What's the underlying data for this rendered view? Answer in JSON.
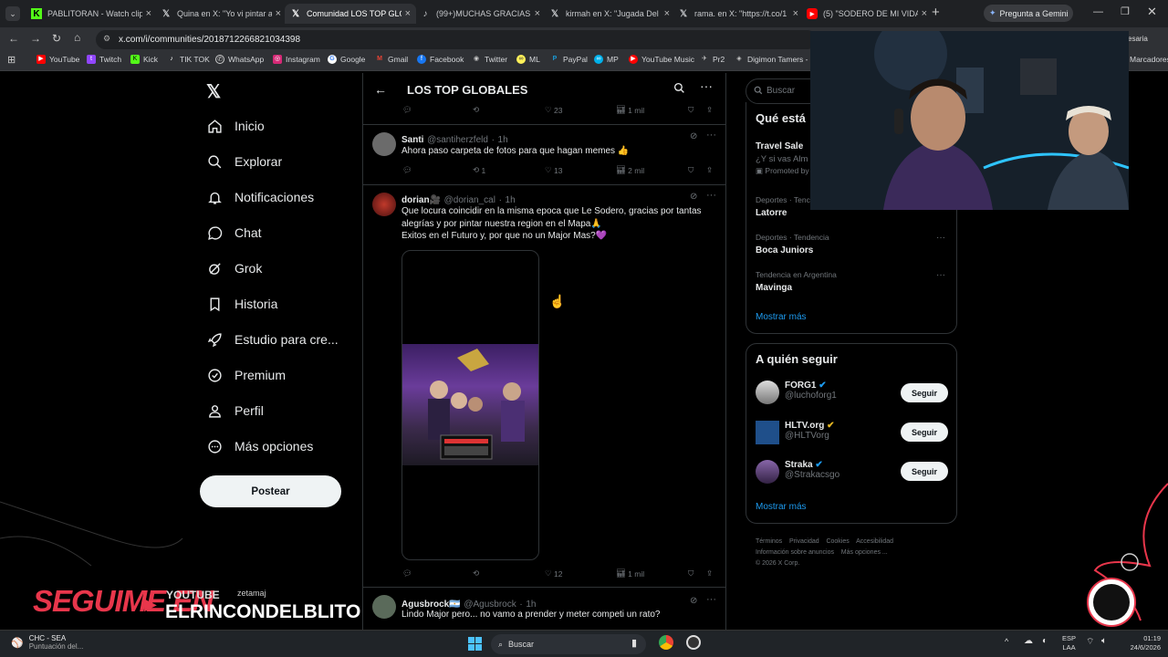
{
  "browser": {
    "tabs": [
      {
        "title": "PABLITORAN - Watch clips",
        "icon": "kick-icon",
        "active": false
      },
      {
        "title": "Quina en X: \"Yo vi pintar a",
        "icon": "x-icon",
        "active": false
      },
      {
        "title": "Comunidad LOS TOP GLOBA",
        "icon": "x-icon",
        "active": true
      },
      {
        "title": "(99+)MUCHAS GRACIAS S",
        "icon": "tiktok-icon",
        "active": false
      },
      {
        "title": "kirmah en X: \"Jugada Del N",
        "icon": "x-icon",
        "active": false
      },
      {
        "title": "rama. en X: \"https://t.co/1",
        "icon": "x-icon",
        "active": false
      },
      {
        "title": "(5) \"SODERO DE MI VIDA\"",
        "icon": "youtube-icon",
        "active": false
      }
    ],
    "gemini_button": "Pregunta a Gemini",
    "url": "x.com/i/communities/2018712266821034398",
    "bookmarks": [
      "YouTube",
      "Twitch",
      "Kick",
      "TIK TOK",
      "WhatsApp",
      "Instagram",
      "Google",
      "Gmail",
      "Facebook",
      "Twitter",
      "ML",
      "PayPal",
      "MP",
      "YouTube Music",
      "Pr2",
      "Digimon Tamers - a"
    ],
    "bookmarks_right": "Marcadores",
    "profile_text": "esaria"
  },
  "sidebar": {
    "items": [
      {
        "label": "Inicio",
        "icon": "home-icon"
      },
      {
        "label": "Explorar",
        "icon": "search-icon"
      },
      {
        "label": "Notificaciones",
        "icon": "bell-icon"
      },
      {
        "label": "Chat",
        "icon": "chat-bubble-icon"
      },
      {
        "label": "Grok",
        "icon": "grok-icon"
      },
      {
        "label": "Historia",
        "icon": "bookmark-icon"
      },
      {
        "label": "Estudio para cre...",
        "icon": "rocket-icon"
      },
      {
        "label": "Premium",
        "icon": "verified-badge-icon"
      },
      {
        "label": "Perfil",
        "icon": "person-icon"
      },
      {
        "label": "Más opciones",
        "icon": "more-circle-icon"
      }
    ],
    "post_button": "Postear"
  },
  "timeline": {
    "title": "LOS TOP GLOBALES",
    "top_actions": {
      "likes": "23",
      "views": "1 mil"
    },
    "posts": [
      {
        "name": "Santi",
        "handle": "@santiherzfeld",
        "time": "1h",
        "text": "Ahora paso carpeta de fotos para que hagan memes 👍",
        "reposts": "1",
        "likes": "13",
        "views": "2 mil"
      },
      {
        "name": "dorian🎥",
        "handle": "@dorian_cal",
        "time": "1h",
        "text_lines": [
          "Que locura coincidir en la misma epoca que Le Sodero, gracias por tantas",
          "alegrías y por pintar nuestra region en el Mapa🙏",
          "Exitos en el Futuro y, por que no un Major Mas?💜"
        ],
        "reposts": "",
        "likes": "12",
        "views": "1 mil"
      },
      {
        "name": "Agusbrock🇦🇷",
        "handle": "@Agusbrock",
        "time": "1h",
        "text": "Lindo Major pero... no vamo a prender y meter competi un rato?"
      }
    ]
  },
  "right": {
    "search_placeholder": "Buscar",
    "trends_title": "Qué está",
    "trends": [
      {
        "label": "Travel Sale",
        "sub": "¿Y si vas Alm",
        "meta": "Promoted by"
      },
      {
        "meta": "Deportes · Tenc",
        "label": "Latorre"
      },
      {
        "meta": "Deportes · Tendencia",
        "label": "Boca Juniors"
      },
      {
        "meta": "Tendencia en Argentina",
        "label": "Mavinga"
      }
    ],
    "show_more": "Mostrar más",
    "follow_title": "A quién seguir",
    "follow": [
      {
        "name": "FORG1",
        "handle": "@luchoforg1",
        "button": "Seguir"
      },
      {
        "name": "HLTV.org",
        "handle": "@HLTVorg",
        "button": "Seguir"
      },
      {
        "name": "Straka",
        "handle": "@Strakacsgo",
        "button": "Seguir"
      }
    ],
    "footer_links": [
      "Términos",
      "Privacidad",
      "Cookies",
      "Accesibilidad",
      "Información sobre anuncios",
      "Más opciones ...",
      "© 2026 X Corp."
    ]
  },
  "overlay": {
    "banner": "SEGUIME EN",
    "platform": "YOUTUBE",
    "small_tag": "zetamaj",
    "channel": "ELRINCONDELBLITO"
  },
  "taskbar": {
    "weather_title": "CHC - SEA",
    "weather_sub": "Puntuación del...",
    "search": "Buscar",
    "lang1": "ESP",
    "lang2": "LAA",
    "time": "01:19",
    "date": "24/6/2026"
  },
  "colors": {
    "accent": "#1d9bf0",
    "background": "#000000",
    "border": "#2f3336",
    "muted": "#71767b",
    "overlay_red": "#e8364b"
  }
}
